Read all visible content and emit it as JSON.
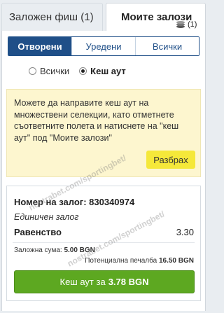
{
  "tabs": {
    "betslip": "Заложен фиш (1)",
    "mybets": "Моите залози",
    "mybets_count": "(1)"
  },
  "segments": [
    "Отворени",
    "Уредени",
    "Всички"
  ],
  "filters": {
    "all": "Всички",
    "cashout": "Кеш аут"
  },
  "notice": {
    "text": "Можете да направите кеш аут на множествени селекции, като отметнете съответните полета и натиснете на \"кеш аут\" под \"Моите залози\"",
    "button": "Разбрах"
  },
  "bet": {
    "id_label": "Номер на залог: 830340974",
    "type": "Единичен залог",
    "outcome": "Равенство",
    "odds": "3.30",
    "stake_label": "Заложна сума:",
    "stake_value": "5.00 BGN",
    "win_label": "Потенциална печалба",
    "win_value": "16.50 BGN",
    "cashout_label": "Кеш аут за",
    "cashout_value": "3.78 BGN"
  },
  "watermark": "nostrabet.com/sportingbet/"
}
